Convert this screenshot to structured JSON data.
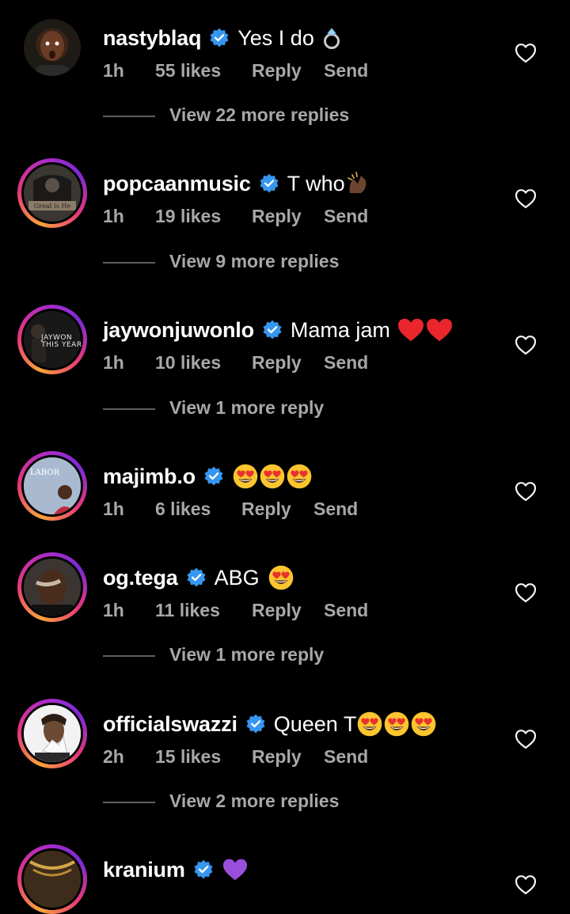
{
  "comments": [
    {
      "username": "nastyblaq",
      "text": "Yes I do",
      "emoji": "ring",
      "time": "1h",
      "likes": "55 likes",
      "reply": "Reply",
      "send": "Send",
      "view_more": "View 22 more replies"
    },
    {
      "username": "popcaanmusic",
      "text": "T who",
      "emoji": "clap",
      "time": "1h",
      "likes": "19 likes",
      "reply": "Reply",
      "send": "Send",
      "view_more": "View 9 more replies"
    },
    {
      "username": "jaywonjuwonlo",
      "text": "Mama jam",
      "emoji": "hearts",
      "time": "1h",
      "likes": "10 likes",
      "reply": "Reply",
      "send": "Send",
      "view_more": "View 1 more reply",
      "avatar_text": "JAYWON THIS YEAR"
    },
    {
      "username": "majimb.o",
      "text": "",
      "emoji": "heart-eyes-3",
      "time": "1h",
      "likes": "6 likes",
      "reply": "Reply",
      "send": "Send",
      "view_more": "",
      "avatar_text": "LABOR"
    },
    {
      "username": "og.tega",
      "text": "ABG",
      "emoji": "heart-eyes-1",
      "time": "1h",
      "likes": "11 likes",
      "reply": "Reply",
      "send": "Send",
      "view_more": "View 1 more reply"
    },
    {
      "username": "officialswazzi",
      "text": "Queen T",
      "emoji": "heart-eyes-3",
      "time": "2h",
      "likes": "15 likes",
      "reply": "Reply",
      "send": "Send",
      "view_more": "View 2 more replies"
    },
    {
      "username": "kranium",
      "text": "",
      "emoji": "purple-heart",
      "time": "",
      "likes": "",
      "reply": "",
      "send": "",
      "view_more": ""
    }
  ],
  "colors": {
    "background": "#000000",
    "verified": "#3797f0",
    "secondary_text": "#a8a8a8",
    "ring_start": "#f9a23b",
    "ring_end": "#b02cc6"
  }
}
